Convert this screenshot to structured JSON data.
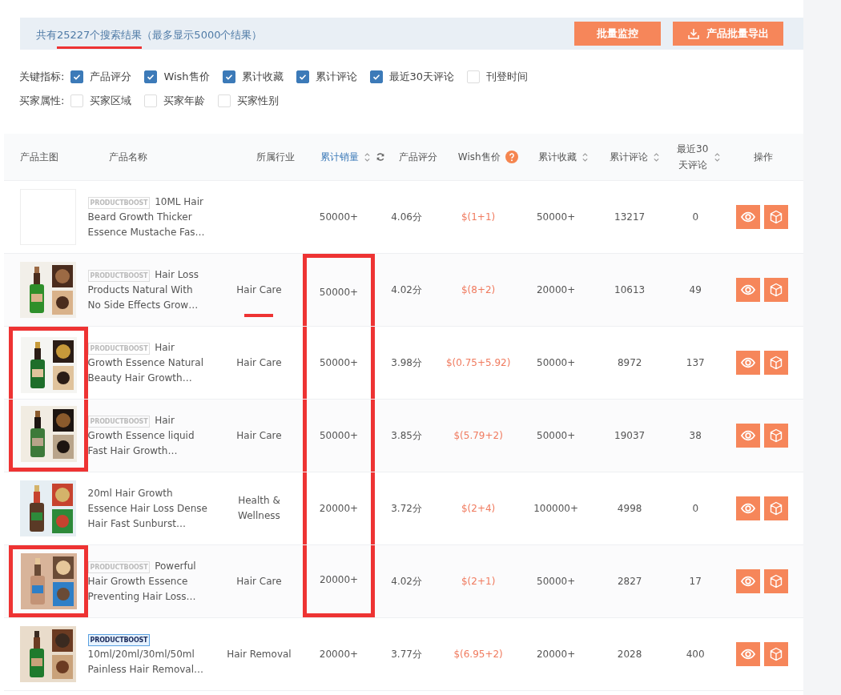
{
  "summary": {
    "prefix": "共有",
    "count": "25227",
    "suffix": "个搜索结果",
    "note": "（最多显示5000个结果）",
    "count_underlined": true
  },
  "actions": [
    {
      "kind": "plain",
      "label": "批量监控"
    },
    {
      "kind": "export",
      "label": "产品批量导出"
    }
  ],
  "filters": [
    {
      "label": "关键指标:",
      "options": [
        {
          "label": "产品评分",
          "checked": true
        },
        {
          "label": "Wish售价",
          "checked": true
        },
        {
          "label": "累计收藏",
          "checked": true
        },
        {
          "label": "累计评论",
          "checked": true
        },
        {
          "label": "最近30天评论",
          "checked": true
        },
        {
          "label": "刊登时间",
          "checked": false
        }
      ]
    },
    {
      "label": "买家属性:",
      "options": [
        {
          "label": "买家区域",
          "checked": false
        },
        {
          "label": "买家年龄",
          "checked": false
        },
        {
          "label": "买家性别",
          "checked": false
        }
      ]
    }
  ],
  "columns": [
    {
      "label": "产品主图",
      "sortable": false,
      "active": false
    },
    {
      "label": "产品名称",
      "sortable": false,
      "active": false
    },
    {
      "label": "所属行业",
      "sortable": false,
      "active": false
    },
    {
      "label": "累计销量",
      "sortable": true,
      "active": true,
      "refresh": true
    },
    {
      "label": "产品评分",
      "sortable": false,
      "active": false
    },
    {
      "label": "Wish售价",
      "sortable": false,
      "active": false,
      "help": true
    },
    {
      "label": "累计收藏",
      "sortable": true,
      "active": false
    },
    {
      "label": "累计评论",
      "sortable": true,
      "active": false
    },
    {
      "label": "最近30天评论",
      "sortable": true,
      "active": false
    },
    {
      "label": "操作",
      "sortable": false,
      "active": false
    }
  ],
  "rows": [
    {
      "image_marked": false,
      "badge": {
        "text": "PRODUCTBOOST",
        "active": false
      },
      "name": "10ML Hair Beard Growth Thicker Essence Mustache Fas…",
      "sales": "50000+",
      "sales_marked": false,
      "rating": "4.06分",
      "price": "$(1+1)",
      "favorites": "50000+",
      "reviews": "13217",
      "recent": "0"
    },
    {
      "image_marked": false,
      "badge": {
        "text": "PRODUCTBOOST",
        "active": false
      },
      "name": "Hair Loss Products Natural With No Side Effects Grow…",
      "industry": "Hair Care",
      "industry_underlined": true,
      "sales": "50000+",
      "sales_marked": true,
      "rating": "4.02分",
      "price": "$(8+2)",
      "favorites": "20000+",
      "reviews": "10613",
      "recent": "49"
    },
    {
      "image_marked": true,
      "badge": {
        "text": "PRODUCTBOOST",
        "active": false
      },
      "name": "Hair Growth Essence Natural Beauty Hair Growth…",
      "industry": "Hair Care",
      "sales": "50000+",
      "sales_marked": true,
      "rating": "3.98分",
      "price": "$(0.75+5.92)",
      "favorites": "50000+",
      "reviews": "8972",
      "recent": "137"
    },
    {
      "image_marked": true,
      "badge": {
        "text": "PRODUCTBOOST",
        "active": false
      },
      "name": "Hair Growth Essence liquid Fast Hair Growth…",
      "industry": "Hair Care",
      "sales": "50000+",
      "sales_marked": true,
      "rating": "3.85分",
      "price": "$(5.79+2)",
      "favorites": "50000+",
      "reviews": "19037",
      "recent": "38"
    },
    {
      "image_marked": false,
      "name": "20ml Hair Growth Essence Hair Loss Dense Hair Fast Sunburst…",
      "industry": "Health & Wellness",
      "sales": "20000+",
      "sales_marked": true,
      "rating": "3.72分",
      "price": "$(2+4)",
      "favorites": "100000+",
      "reviews": "4998",
      "recent": "0"
    },
    {
      "image_marked": true,
      "badge": {
        "text": "PRODUCTBOOST",
        "active": false
      },
      "name": "Powerful Hair Growth Essence Preventing Hair Loss…",
      "industry": "Hair Care",
      "sales": "20000+",
      "sales_marked": true,
      "rating": "4.02分",
      "price": "$(2+1)",
      "favorites": "50000+",
      "reviews": "2827",
      "recent": "17"
    },
    {
      "image_marked": false,
      "badge": {
        "text": "PRODUCTBOOST",
        "active": true
      },
      "name": "10ml/20ml/30ml/50ml Painless Hair Removal…",
      "industry": "Hair Removal",
      "sales": "20000+",
      "sales_marked": false,
      "rating": "3.77分",
      "price": "$(6.95+2)",
      "favorites": "20000+",
      "reviews": "2028",
      "recent": "400"
    }
  ]
}
